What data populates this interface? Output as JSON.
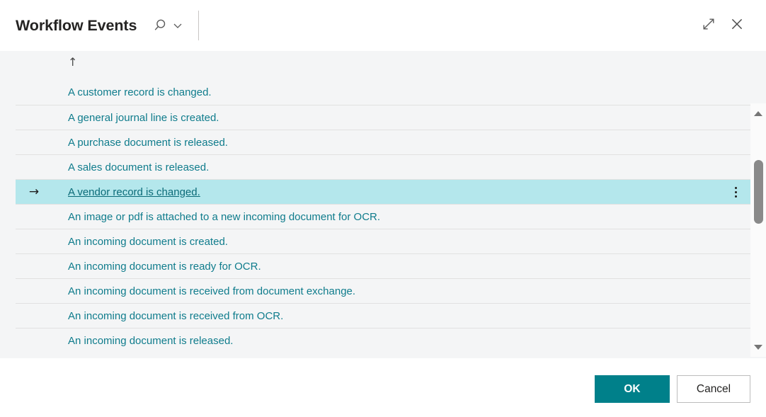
{
  "window": {
    "title": "Workflow Events",
    "search_icon": "search-icon",
    "chevron_icon": "chevron-down-icon",
    "expand_icon": "expand-icon",
    "close_icon": "close-icon"
  },
  "grid": {
    "sort_indicator": "↑",
    "selected_indicator": "→",
    "row_menu_icon": "more-vertical-icon",
    "rows": [
      {
        "label": "A customer record is changed.",
        "selected": false
      },
      {
        "label": "A general journal line is created.",
        "selected": false
      },
      {
        "label": "A purchase document is released.",
        "selected": false
      },
      {
        "label": "A sales document is released.",
        "selected": false
      },
      {
        "label": "A vendor record is changed.",
        "selected": true
      },
      {
        "label": "An image or pdf is attached to a new incoming document for OCR.",
        "selected": false
      },
      {
        "label": "An incoming document is created.",
        "selected": false
      },
      {
        "label": "An incoming document is ready for OCR.",
        "selected": false
      },
      {
        "label": "An incoming document is received from document exchange.",
        "selected": false
      },
      {
        "label": "An incoming document is received from OCR.",
        "selected": false
      },
      {
        "label": "An incoming document is released.",
        "selected": false
      }
    ]
  },
  "scrollbar": {
    "up_arrow": "scroll-up-arrow",
    "down_arrow": "scroll-down-arrow",
    "thumb": "scroll-thumb"
  },
  "footer": {
    "ok_label": "OK",
    "cancel_label": "Cancel"
  },
  "colors": {
    "accent": "#00808a",
    "link": "#0f7c8c",
    "selected_row": "#b4e7ec",
    "body_background": "#f4f5f6",
    "header_background": "#ffffff"
  }
}
